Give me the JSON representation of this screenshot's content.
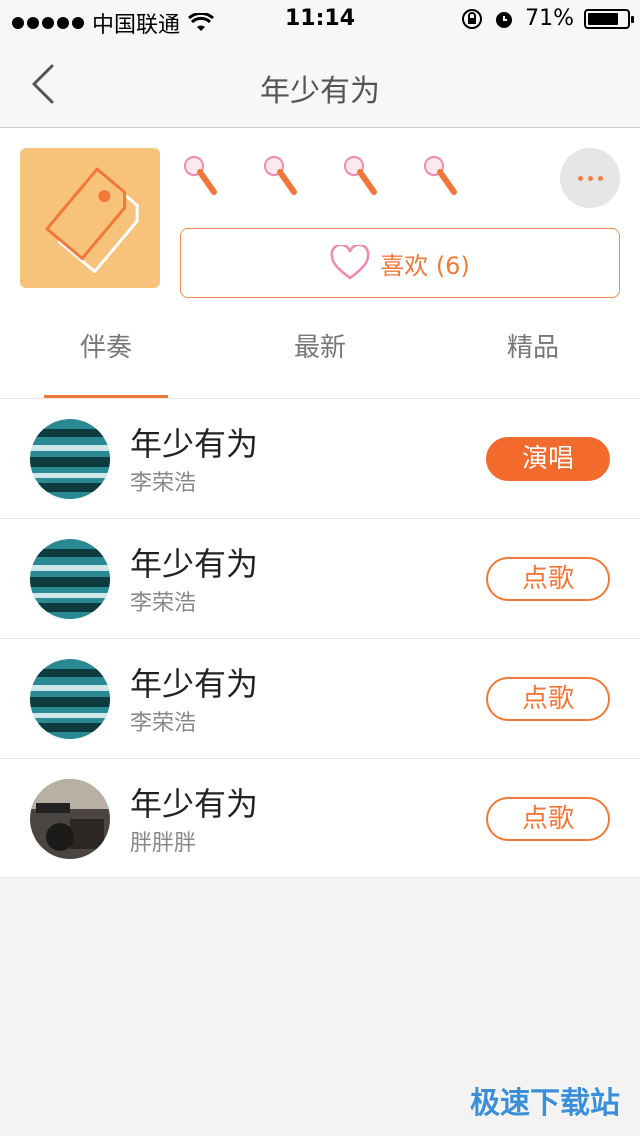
{
  "status_bar": {
    "carrier": "中国联通",
    "time": "11:14",
    "battery": "71%"
  },
  "nav": {
    "title": "年少有为"
  },
  "header": {
    "like_label": "喜欢 (6)"
  },
  "tabs": [
    {
      "label": "伴奏"
    },
    {
      "label": "最新"
    },
    {
      "label": "精品"
    }
  ],
  "songs": [
    {
      "title": "年少有为",
      "artist": "李荣浩",
      "action": "演唱"
    },
    {
      "title": "年少有为",
      "artist": "李荣浩",
      "action": "点歌"
    },
    {
      "title": "年少有为",
      "artist": "李荣浩",
      "action": "点歌"
    },
    {
      "title": "年少有为",
      "artist": "胖胖胖",
      "action": "点歌"
    }
  ],
  "watermark": "极速下载站",
  "colors": {
    "accent": "#f26b2c",
    "cover_bg": "#f7c27a"
  },
  "icons": [
    "back-icon",
    "tag-icon",
    "mic-icon",
    "more-icon",
    "heart-icon",
    "wifi-icon",
    "battery-icon"
  ]
}
